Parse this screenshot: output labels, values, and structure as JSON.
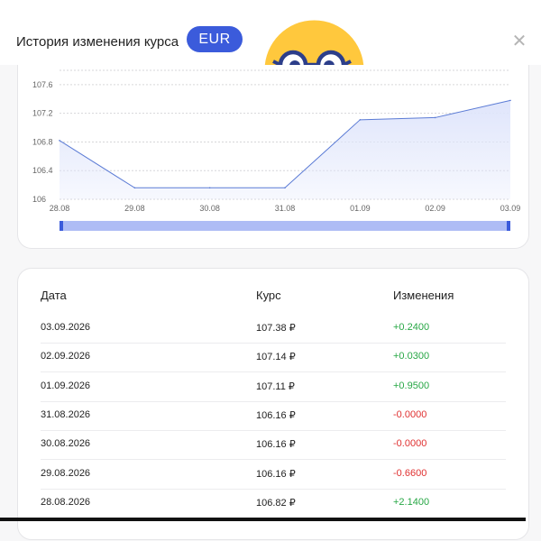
{
  "header": {
    "title": "История изменения курса",
    "currency": "EUR"
  },
  "icons": {
    "close": "close-icon",
    "emoji": "nerd-frown-emoji-icon"
  },
  "colors": {
    "accent": "#3b5bdb",
    "line": "#5b7bd5",
    "fill": "#dfe5fb",
    "slider": "#aebcf5",
    "positive": "#27a745",
    "negative": "#e03131"
  },
  "chart_data": {
    "type": "area",
    "x": [
      "28.08",
      "29.08",
      "30.08",
      "31.08",
      "01.09",
      "02.09",
      "03.09"
    ],
    "values": [
      106.82,
      106.16,
      106.16,
      106.16,
      107.11,
      107.14,
      107.38
    ],
    "yticks": [
      106,
      106.4,
      106.8,
      107.2,
      107.6
    ],
    "ylim": [
      106,
      107.8
    ],
    "grid": true
  },
  "table": {
    "headers": {
      "date": "Дата",
      "rate": "Курс",
      "change": "Изменения"
    },
    "rows": [
      {
        "date": "03.09.2026",
        "rate": "107.38 ₽",
        "change": "+0.2400",
        "sign": "pos"
      },
      {
        "date": "02.09.2026",
        "rate": "107.14 ₽",
        "change": "+0.0300",
        "sign": "pos"
      },
      {
        "date": "01.09.2026",
        "rate": "107.11 ₽",
        "change": "+0.9500",
        "sign": "pos"
      },
      {
        "date": "31.08.2026",
        "rate": "106.16 ₽",
        "change": "-0.0000",
        "sign": "neg"
      },
      {
        "date": "30.08.2026",
        "rate": "106.16 ₽",
        "change": "-0.0000",
        "sign": "neg"
      },
      {
        "date": "29.08.2026",
        "rate": "106.16 ₽",
        "change": "-0.6600",
        "sign": "neg"
      },
      {
        "date": "28.08.2026",
        "rate": "106.82 ₽",
        "change": "+2.1400",
        "sign": "pos"
      }
    ]
  }
}
